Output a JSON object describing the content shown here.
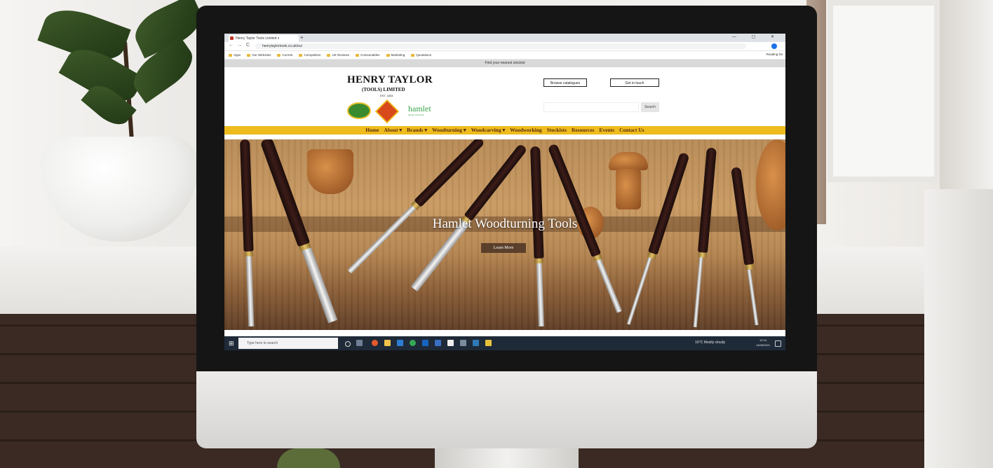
{
  "browser": {
    "tab_title": "Henry Taylor Tools Limited x",
    "new_tab": "+",
    "window_controls": "— ▢ ✕",
    "nav": {
      "back": "←",
      "forward": "→",
      "reload": "C"
    },
    "url": "henrytaylortools.co.uk/eu/",
    "bookmarks": [
      "Apps",
      "Our Websites",
      "Current",
      "Competition",
      "UK Reviews",
      "Consumables",
      "Marketing",
      "Quotations"
    ],
    "reading_list": "Reading list"
  },
  "site": {
    "top_strip": "Find your nearest stockist",
    "logo": {
      "name": "HENRY TAYLOR",
      "sub": "(TOOLS) LIMITED",
      "est": "EST. 1834"
    },
    "brand": {
      "name": "hamlet",
      "tagline": "hamlet craft tools"
    },
    "buttons": {
      "catalogues": "Browse catalogues",
      "contact": "Get in touch"
    },
    "search": {
      "placeholder": "",
      "button": "Search"
    },
    "nav": [
      "Home",
      "About ▾",
      "Brands ▾",
      "Woodturning ▾",
      "Woodcarving ▾",
      "Woodworking",
      "Stockists",
      "Resources",
      "Events",
      "Contact Us"
    ],
    "hero": {
      "title": "Hamlet Woodturning Tools",
      "cta": "Learn More"
    }
  },
  "taskbar": {
    "search_placeholder": "Type here to search",
    "weather": "16°C  Mostly cloudy",
    "time": "12:16",
    "date": "14/06/2021"
  },
  "colors": {
    "nav_bar": "#eebc1d",
    "nav_text": "#5a2a12",
    "taskbar": "#1f2a38"
  }
}
